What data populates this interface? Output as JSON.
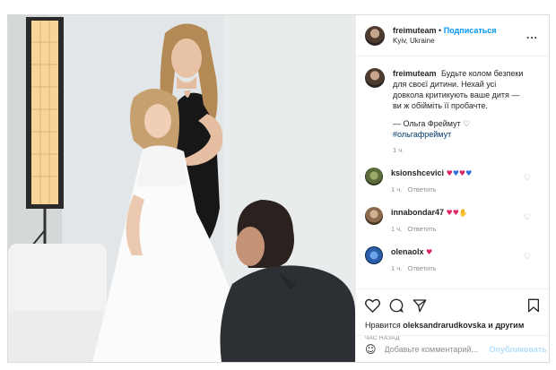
{
  "post": {
    "username": "freimuteam",
    "follow_label": "Подписаться",
    "separator": "•",
    "location": "Kyiv, Ukraine",
    "more_label": "..."
  },
  "caption": {
    "username": "freimuteam",
    "text": "Будьте колом безпеки для своєї дитини. Нехай усі довкола критикують ваше дитя — ви ж обійміть її пробачте.",
    "signature": "— Ольга Фреймут ♡",
    "hashtag": "#ольгафреймут",
    "time": "1 ч."
  },
  "comments": [
    {
      "username": "ksionshcevici",
      "emoji": [
        "heart-red",
        "heart-blue",
        "heart-red",
        "heart-blue"
      ],
      "time": "1 ч.",
      "reply_label": "Ответить"
    },
    {
      "username": "innabondar47",
      "emoji": [
        "heart-red",
        "heart-red",
        "raised-hands"
      ],
      "time": "1 ч.",
      "reply_label": "Ответить"
    },
    {
      "username": "olenaolx",
      "emoji": [
        "heart-red"
      ],
      "time": "1 ч.",
      "reply_label": "Ответить"
    }
  ],
  "likes": {
    "prefix": "Нравится",
    "user": "oleksandrarudkovska",
    "suffix": "и другим"
  },
  "posted_ago": "ЧАС НАЗАД",
  "add_comment": {
    "placeholder": "Добавьте комментарий...",
    "publish_label": "Опубликовать"
  },
  "colors": {
    "link_blue": "#0095f6",
    "hashtag_blue": "#00376b",
    "muted_gray": "#8e8e8e",
    "publish_disabled": "#b2dffc",
    "heart_red": "#e0245e",
    "heart_blue": "#2e6fd8"
  },
  "icons": [
    "heart-outline-icon",
    "comment-icon",
    "share-icon",
    "bookmark-icon",
    "smile-icon",
    "more-icon"
  ]
}
